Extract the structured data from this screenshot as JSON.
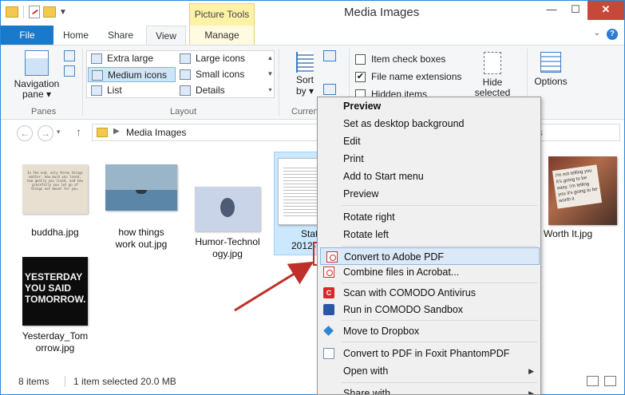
{
  "window": {
    "title": "Media Images",
    "contextual_tab": "Picture Tools",
    "controls": {
      "minimize": "—",
      "maximize": "☐",
      "close": "✕"
    }
  },
  "ribbon_tabs": {
    "file": "File",
    "home": "Home",
    "share": "Share",
    "view": "View",
    "manage": "Manage"
  },
  "ribbon": {
    "nav_pane_label_1": "Navigation",
    "nav_pane_label_2": "pane ▾",
    "panes_group": "Panes",
    "layout_group": "Layout",
    "current_view_group": "Curren",
    "layout_items": {
      "extra_large": "Extra large icons",
      "large": "Large icons",
      "medium": "Medium icons",
      "small": "Small icons",
      "list": "List",
      "details": "Details"
    },
    "sort_label_1": "Sort",
    "sort_label_2": "by ▾",
    "checks": {
      "item_check_boxes": "Item check boxes",
      "file_name_extensions": "File name extensions",
      "hidden_items": "Hidden items",
      "file_name_extensions_checked": "✔"
    },
    "hide_selected_1": "Hide selected",
    "hide_selected_2": "items",
    "options": "Options"
  },
  "address": {
    "back": "←",
    "forward": "→",
    "up": "↑",
    "chevron": "▶",
    "path": "Media Images",
    "search_fragment": "s"
  },
  "files": {
    "buddha": {
      "name": "buddha.jpg",
      "thumb_text": "In the end, only three things matter: how much you loved, how gently you lived, and how gracefully you let go of things not meant for you."
    },
    "work": {
      "name_1": "how things",
      "name_2": "work out.jpg"
    },
    "humor": {
      "name_1": "Humor-Technol",
      "name_2": "ogy.jpg"
    },
    "stat": {
      "name_1": "Stat",
      "name_2": "2012-"
    },
    "worth": {
      "name": "Worth It.jpg",
      "sign_text": "i'm not telling you it's going to be easy. i'm telling you it's going to be worth it"
    },
    "yesterday": {
      "name_1": "Yesterday_Tom",
      "name_2": "orrow.jpg",
      "thumb_text_1": "YESTERDAY",
      "thumb_text_2": "YOU SAID",
      "thumb_text_3": "TOMORROW."
    }
  },
  "status": {
    "count": "8 items",
    "selection": "1 item selected  20.0 MB"
  },
  "context_menu": {
    "preview_default": "Preview",
    "set_background": "Set as desktop background",
    "edit": "Edit",
    "print": "Print",
    "add_start": "Add to Start menu",
    "preview": "Preview",
    "rotate_right": "Rotate right",
    "rotate_left": "Rotate left",
    "convert_pdf": "Convert to Adobe PDF",
    "combine_acrobat": "Combine files in Acrobat...",
    "scan_comodo": "Scan with COMODO Antivirus",
    "run_comodo": "Run in COMODO Sandbox",
    "dropbox": "Move to Dropbox",
    "foxit": "Convert to PDF in Foxit PhantomPDF",
    "open_with": "Open with",
    "share_with": "Share with",
    "comodo_letter": "C"
  },
  "colors": {
    "accent": "#1979ca",
    "highlight_box": "#c0302a",
    "selection": "#cce8ff"
  }
}
